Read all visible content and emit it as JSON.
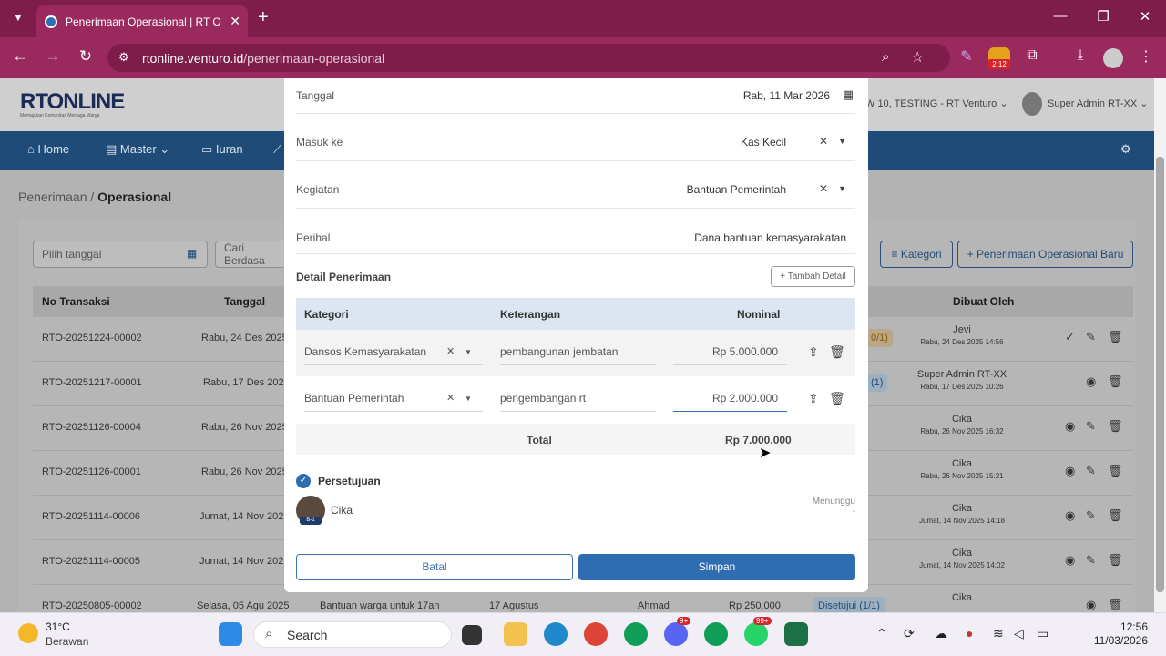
{
  "browser": {
    "tab_title": "Penerimaan Operasional | RT O",
    "url_domain": "rtonline.venturo.id",
    "url_path": "/penerimaan-operasional",
    "ext_badge": "2:12"
  },
  "header": {
    "logo": "RTONLINE",
    "tagline": "Memajukan Komunitas Menjaga Warga",
    "org": "W 10, TESTING - RT Venturo",
    "user": "Super Admin RT-XX"
  },
  "nav": {
    "items": [
      "Home",
      "Master",
      "Iuran"
    ]
  },
  "breadcrumb": {
    "parent": "Penerimaan",
    "current": "Operasional"
  },
  "filters": {
    "date_placeholder": "Pilih tanggal",
    "search_placeholder": "Cari Berdasa",
    "kategori_btn": "Kategori",
    "new_btn": "Penerimaan Operasional Baru"
  },
  "table": {
    "headers": [
      "No Transaksi",
      "Tanggal",
      "Dibuat Oleh"
    ],
    "rows": [
      {
        "no": "RTO-20251224-00002",
        "date": "Rabu, 24 Des 2025",
        "badge": "0/1)",
        "by": "Jevi",
        "by_date": "Rabu, 24 Des 2025 14:56"
      },
      {
        "no": "RTO-20251217-00001",
        "date": "Rabu, 17 Des 2025",
        "badge": "(1)",
        "by": "Super Admin RT-XX",
        "by_date": "Rabu, 17 Des 2025 10:26"
      },
      {
        "no": "RTO-20251126-00004",
        "date": "Rabu, 26 Nov 2025",
        "badge": "",
        "by": "Cika",
        "by_date": "Rabu, 26 Nov 2025 16:32"
      },
      {
        "no": "RTO-20251126-00001",
        "date": "Rabu, 26 Nov 2025",
        "badge": "",
        "by": "Cika",
        "by_date": "Rabu, 26 Nov 2025 15:21"
      },
      {
        "no": "RTO-20251114-00006",
        "date": "Jumat, 14 Nov 2025",
        "badge": "",
        "by": "Cika",
        "by_date": "Jumat, 14 Nov 2025 14:18"
      },
      {
        "no": "RTO-20251114-00005",
        "date": "Jumat, 14 Nov 2025",
        "badge": "",
        "by": "Cika",
        "by_date": "Jumat, 14 Nov 2025 14:02"
      },
      {
        "no": "RTO-20250805-00002",
        "date": "Selasa, 05 Agu 2025",
        "desc": "Bantuan warga untuk 17an",
        "ket": "17 Agustus",
        "person": "Ahmad",
        "amount": "Rp 250.000",
        "badge": "Disetujui (1/1)",
        "by": "Cika",
        "by_date": ""
      }
    ]
  },
  "modal": {
    "fields": [
      {
        "label": "Tanggal",
        "value": "Rab, 11 Mar 2026"
      },
      {
        "label": "Masuk ke",
        "value": "Kas Kecil"
      },
      {
        "label": "Kegiatan",
        "value": "Bantuan Pemerintah"
      },
      {
        "label": "Perihal",
        "value": "Dana bantuan kemasyarakatan"
      }
    ],
    "detail_title": "Detail Penerimaan",
    "add_detail": "+ Tambah Detail",
    "detail_headers": [
      "Kategori",
      "Keterangan",
      "Nominal"
    ],
    "details": [
      {
        "kategori": "Dansos Kemasyarakatan",
        "keterangan": "pembangunan jembatan",
        "nominal": "Rp 5.000.000"
      },
      {
        "kategori": "Bantuan Pemerintah",
        "keterangan": "pengembangan rt",
        "nominal": "Rp 2.000.000"
      }
    ],
    "total_label": "Total",
    "total_value": "Rp 7.000.000",
    "approval_title": "Persetujuan",
    "approver": {
      "name": "Cika",
      "tag": "B-1",
      "status": "Menunggu",
      "status_sub": "-"
    },
    "cancel_label": "Batal",
    "save_label": "Simpan"
  },
  "taskbar": {
    "temp": "31°C",
    "weather": "Berawan",
    "search": "Search",
    "time": "12:56",
    "date": "11/03/2026",
    "whatsapp_badge": "99+",
    "discord_badge": "9+"
  }
}
